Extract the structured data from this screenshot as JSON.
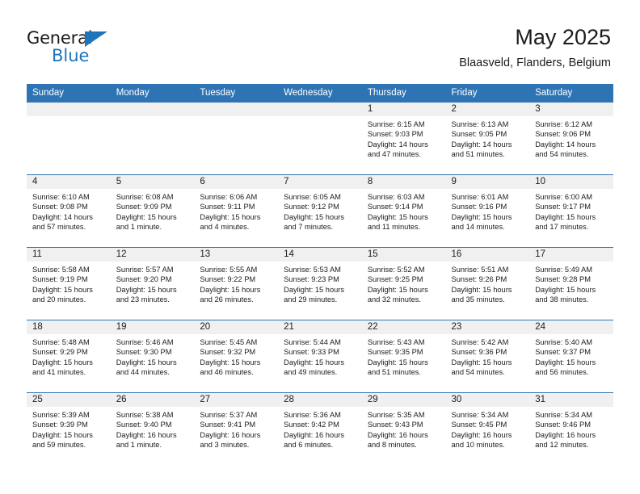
{
  "brand": {
    "name_line1": "General",
    "name_line2": "Blue",
    "triangle_icon": "blue-triangle-icon",
    "accent_color": "#1e74bb"
  },
  "header": {
    "title": "May 2025",
    "subtitle": "Blaasveld, Flanders, Belgium"
  },
  "calendar": {
    "header_bg": "#2e74b5",
    "daynum_band_bg": "#f0f0f0",
    "weekdays": [
      "Sunday",
      "Monday",
      "Tuesday",
      "Wednesday",
      "Thursday",
      "Friday",
      "Saturday"
    ],
    "weeks": [
      [
        {
          "day": "",
          "info": "",
          "blank": true
        },
        {
          "day": "",
          "info": "",
          "blank": true
        },
        {
          "day": "",
          "info": "",
          "blank": true
        },
        {
          "day": "",
          "info": "",
          "blank": true
        },
        {
          "day": "1",
          "info": "Sunrise: 6:15 AM\nSunset: 9:03 PM\nDaylight: 14 hours\nand 47 minutes."
        },
        {
          "day": "2",
          "info": "Sunrise: 6:13 AM\nSunset: 9:05 PM\nDaylight: 14 hours\nand 51 minutes."
        },
        {
          "day": "3",
          "info": "Sunrise: 6:12 AM\nSunset: 9:06 PM\nDaylight: 14 hours\nand 54 minutes."
        }
      ],
      [
        {
          "day": "4",
          "info": "Sunrise: 6:10 AM\nSunset: 9:08 PM\nDaylight: 14 hours\nand 57 minutes."
        },
        {
          "day": "5",
          "info": "Sunrise: 6:08 AM\nSunset: 9:09 PM\nDaylight: 15 hours\nand 1 minute."
        },
        {
          "day": "6",
          "info": "Sunrise: 6:06 AM\nSunset: 9:11 PM\nDaylight: 15 hours\nand 4 minutes."
        },
        {
          "day": "7",
          "info": "Sunrise: 6:05 AM\nSunset: 9:12 PM\nDaylight: 15 hours\nand 7 minutes."
        },
        {
          "day": "8",
          "info": "Sunrise: 6:03 AM\nSunset: 9:14 PM\nDaylight: 15 hours\nand 11 minutes."
        },
        {
          "day": "9",
          "info": "Sunrise: 6:01 AM\nSunset: 9:16 PM\nDaylight: 15 hours\nand 14 minutes."
        },
        {
          "day": "10",
          "info": "Sunrise: 6:00 AM\nSunset: 9:17 PM\nDaylight: 15 hours\nand 17 minutes."
        }
      ],
      [
        {
          "day": "11",
          "info": "Sunrise: 5:58 AM\nSunset: 9:19 PM\nDaylight: 15 hours\nand 20 minutes."
        },
        {
          "day": "12",
          "info": "Sunrise: 5:57 AM\nSunset: 9:20 PM\nDaylight: 15 hours\nand 23 minutes."
        },
        {
          "day": "13",
          "info": "Sunrise: 5:55 AM\nSunset: 9:22 PM\nDaylight: 15 hours\nand 26 minutes."
        },
        {
          "day": "14",
          "info": "Sunrise: 5:53 AM\nSunset: 9:23 PM\nDaylight: 15 hours\nand 29 minutes."
        },
        {
          "day": "15",
          "info": "Sunrise: 5:52 AM\nSunset: 9:25 PM\nDaylight: 15 hours\nand 32 minutes."
        },
        {
          "day": "16",
          "info": "Sunrise: 5:51 AM\nSunset: 9:26 PM\nDaylight: 15 hours\nand 35 minutes."
        },
        {
          "day": "17",
          "info": "Sunrise: 5:49 AM\nSunset: 9:28 PM\nDaylight: 15 hours\nand 38 minutes."
        }
      ],
      [
        {
          "day": "18",
          "info": "Sunrise: 5:48 AM\nSunset: 9:29 PM\nDaylight: 15 hours\nand 41 minutes."
        },
        {
          "day": "19",
          "info": "Sunrise: 5:46 AM\nSunset: 9:30 PM\nDaylight: 15 hours\nand 44 minutes."
        },
        {
          "day": "20",
          "info": "Sunrise: 5:45 AM\nSunset: 9:32 PM\nDaylight: 15 hours\nand 46 minutes."
        },
        {
          "day": "21",
          "info": "Sunrise: 5:44 AM\nSunset: 9:33 PM\nDaylight: 15 hours\nand 49 minutes."
        },
        {
          "day": "22",
          "info": "Sunrise: 5:43 AM\nSunset: 9:35 PM\nDaylight: 15 hours\nand 51 minutes."
        },
        {
          "day": "23",
          "info": "Sunrise: 5:42 AM\nSunset: 9:36 PM\nDaylight: 15 hours\nand 54 minutes."
        },
        {
          "day": "24",
          "info": "Sunrise: 5:40 AM\nSunset: 9:37 PM\nDaylight: 15 hours\nand 56 minutes."
        }
      ],
      [
        {
          "day": "25",
          "info": "Sunrise: 5:39 AM\nSunset: 9:39 PM\nDaylight: 15 hours\nand 59 minutes."
        },
        {
          "day": "26",
          "info": "Sunrise: 5:38 AM\nSunset: 9:40 PM\nDaylight: 16 hours\nand 1 minute."
        },
        {
          "day": "27",
          "info": "Sunrise: 5:37 AM\nSunset: 9:41 PM\nDaylight: 16 hours\nand 3 minutes."
        },
        {
          "day": "28",
          "info": "Sunrise: 5:36 AM\nSunset: 9:42 PM\nDaylight: 16 hours\nand 6 minutes."
        },
        {
          "day": "29",
          "info": "Sunrise: 5:35 AM\nSunset: 9:43 PM\nDaylight: 16 hours\nand 8 minutes."
        },
        {
          "day": "30",
          "info": "Sunrise: 5:34 AM\nSunset: 9:45 PM\nDaylight: 16 hours\nand 10 minutes."
        },
        {
          "day": "31",
          "info": "Sunrise: 5:34 AM\nSunset: 9:46 PM\nDaylight: 16 hours\nand 12 minutes."
        }
      ]
    ]
  }
}
